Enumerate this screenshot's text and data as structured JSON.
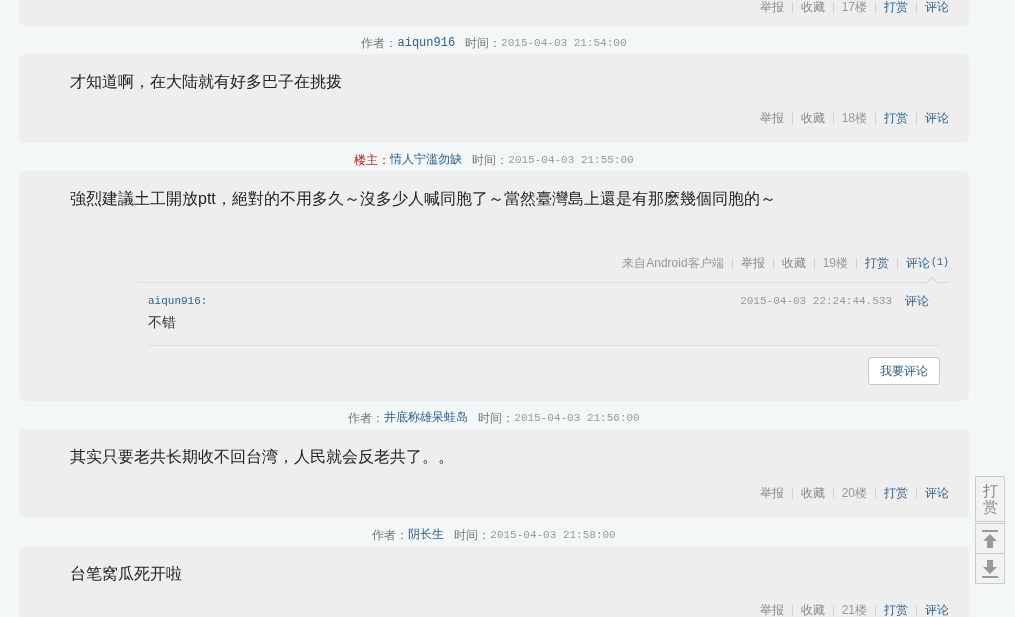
{
  "posts": [
    {
      "actions": [
        {
          "label": "举报",
          "kind": "muted_link"
        },
        {
          "label": "收藏",
          "kind": "muted_link"
        },
        {
          "label": "17楼",
          "kind": "label"
        },
        {
          "label": "打赏",
          "kind": "link"
        },
        {
          "label": "评论",
          "kind": "link"
        }
      ]
    },
    {
      "meta": {
        "kind": "author",
        "label": "作者：",
        "user": "aiqun916",
        "time_label": "时间：",
        "time": "2015-04-03 21:54:00"
      },
      "body": "才知道啊，在大陆就有好多巴子在挑拨",
      "actions": [
        {
          "label": "举报",
          "kind": "muted_link"
        },
        {
          "label": "收藏",
          "kind": "muted_link"
        },
        {
          "label": "18楼",
          "kind": "label"
        },
        {
          "label": "打赏",
          "kind": "link"
        },
        {
          "label": "评论",
          "kind": "link"
        }
      ]
    },
    {
      "meta": {
        "kind": "owner",
        "label": "楼主：",
        "user": "情人宁滥勿缺",
        "time_label": "时间：",
        "time": "2015-04-03 21:55:00"
      },
      "body": "強烈建議土工開放ptt，絕對的不用多久～沒多少人喊同胞了～當然臺灣島上還是有那麽幾個同胞的～",
      "actions": [
        {
          "label": "来自Android客户端",
          "kind": "label"
        },
        {
          "label": "举报",
          "kind": "muted_link"
        },
        {
          "label": "收藏",
          "kind": "muted_link"
        },
        {
          "label": "19楼",
          "kind": "label"
        },
        {
          "label": "打赏",
          "kind": "link"
        },
        {
          "label": "评论",
          "kind": "link",
          "count": "(1)"
        }
      ],
      "comments": {
        "replies": [
          {
            "user": "aiqun916:",
            "time": "2015-04-03 22:24:44.533",
            "action": "评论",
            "text": "不错"
          }
        ],
        "button": "我要评论"
      }
    },
    {
      "meta": {
        "kind": "author",
        "label": "作者：",
        "user": "井底称雄呆蛙岛",
        "time_label": "时间：",
        "time": "2015-04-03 21:56:00"
      },
      "body": "其实只要老共长期收不回台湾，人民就会反老共了。。",
      "actions": [
        {
          "label": "举报",
          "kind": "muted_link"
        },
        {
          "label": "收藏",
          "kind": "muted_link"
        },
        {
          "label": "20楼",
          "kind": "label"
        },
        {
          "label": "打赏",
          "kind": "link"
        },
        {
          "label": "评论",
          "kind": "link"
        }
      ]
    },
    {
      "meta": {
        "kind": "author",
        "label": "作者：",
        "user": "阴长生",
        "time_label": "时间：",
        "time": "2015-04-03 21:58:00"
      },
      "body": "台笔窝瓜死开啦",
      "actions": [
        {
          "label": "举报",
          "kind": "muted_link"
        },
        {
          "label": "收藏",
          "kind": "muted_link"
        },
        {
          "label": "21楼",
          "kind": "label"
        },
        {
          "label": "打赏",
          "kind": "link"
        },
        {
          "label": "评论",
          "kind": "link"
        }
      ]
    }
  ],
  "side_bar": {
    "label": "打赏"
  }
}
